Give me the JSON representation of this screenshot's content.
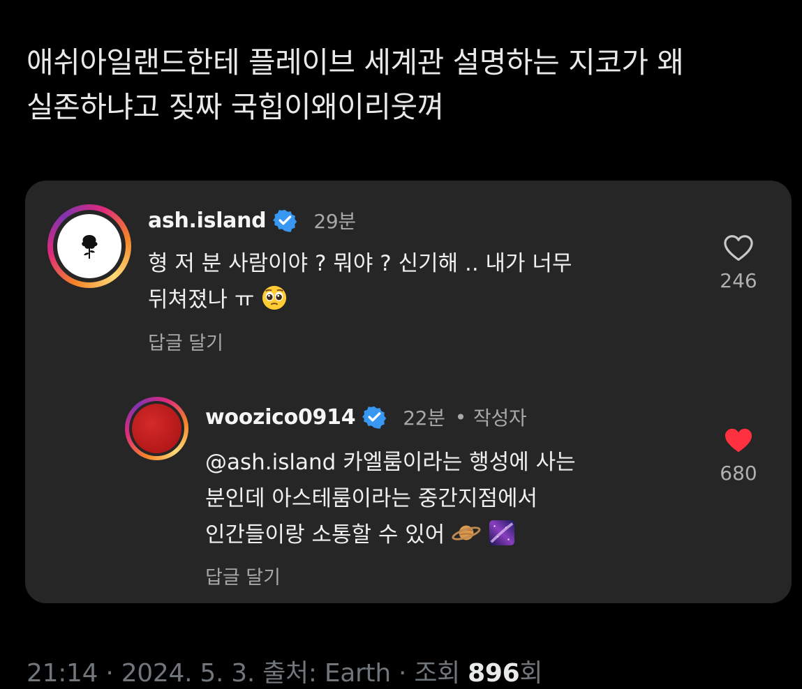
{
  "tweet": {
    "line1": "애쉬아일랜드한테 플레이브 세계관 설명하는 지코가 왜",
    "line2": "실존하냐고 짖짜 국힙이왜이리웃껴"
  },
  "comments": [
    {
      "username": "ash.island",
      "time": "29분",
      "text_line1": "형 저 분 사람이야 ? 뭐야 ? 신기해 .. 내가 너무",
      "text_line2": "뒤쳐졌나 ㅠ",
      "reply_label": "답글 달기",
      "likes": "246",
      "liked": false
    },
    {
      "username": "woozico0914",
      "time": "22분",
      "author_tag": "작성자",
      "text_line1": "@ash.island 카엘룸이라는 행성에 사는",
      "text_line2": "분인데 아스테룸이라는 중간지점에서",
      "text_line3": "인간들이랑 소통할 수 있어",
      "reply_label": "답글 달기",
      "likes": "680",
      "liked": true
    }
  ],
  "footer": {
    "time": "21:14",
    "date": "2024. 5. 3.",
    "source_label": "출처: Earth",
    "views_label": "조회",
    "views_count": "896",
    "views_suffix": "회"
  },
  "colors": {
    "background": "#000000",
    "card": "#262626",
    "verified": "#3897f0",
    "like_red": "#ff3040"
  }
}
